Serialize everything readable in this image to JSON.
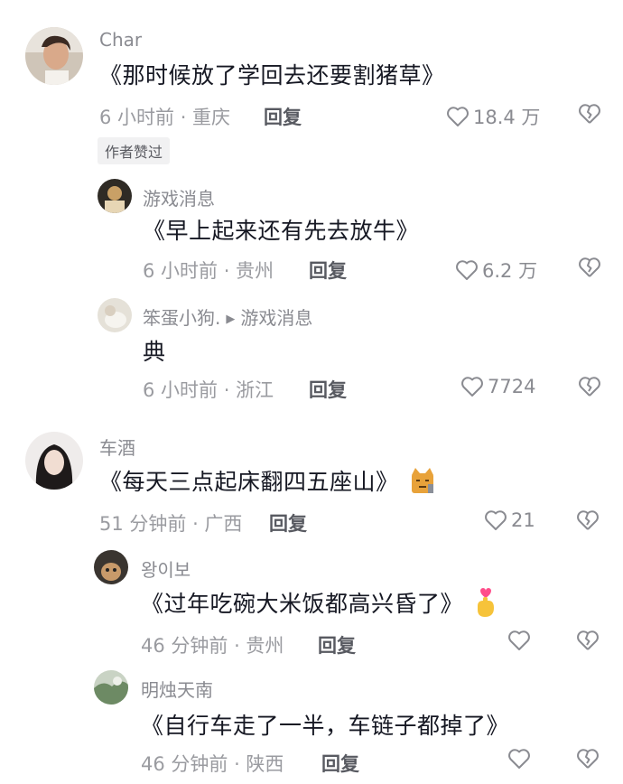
{
  "comments": [
    {
      "username": "Char",
      "text": "《那时候放了学回去还要割猪草》",
      "meta": "6 小时前 · 重庆",
      "reply_label": "回复",
      "likes": "18.4 万",
      "badge": "作者赞过"
    },
    {
      "username": "游戏消息",
      "text": "《早上起来还有先去放牛》",
      "meta": "6 小时前 · 贵州",
      "reply_label": "回复",
      "likes": "6.2 万"
    },
    {
      "username": "笨蛋小狗.",
      "reply_to": "游戏消息",
      "text": "典",
      "meta": "6 小时前 · 浙江",
      "reply_label": "回复",
      "likes": "7724"
    },
    {
      "username": "车酒",
      "text": "《每天三点起床翻四五座山》",
      "meta": "51 分钟前 · 广西",
      "reply_label": "回复",
      "likes": "21",
      "emoji": "cat-face-emoji"
    },
    {
      "username": "왕이보",
      "text": "《过年吃碗大米饭都高兴昏了》",
      "meta": "46 分钟前 · 贵州",
      "reply_label": "回复",
      "likes": "",
      "emoji": "finger-heart-emoji"
    },
    {
      "username": "明烛天南",
      "text": "《自行车走了一半，车链子都掉了》",
      "meta": "46 分钟前 · 陕西",
      "reply_label": "回复",
      "likes": ""
    }
  ],
  "colors": {
    "text": "#161823",
    "secondary": "#8a8b91",
    "badge_bg": "#f1f1f2"
  }
}
